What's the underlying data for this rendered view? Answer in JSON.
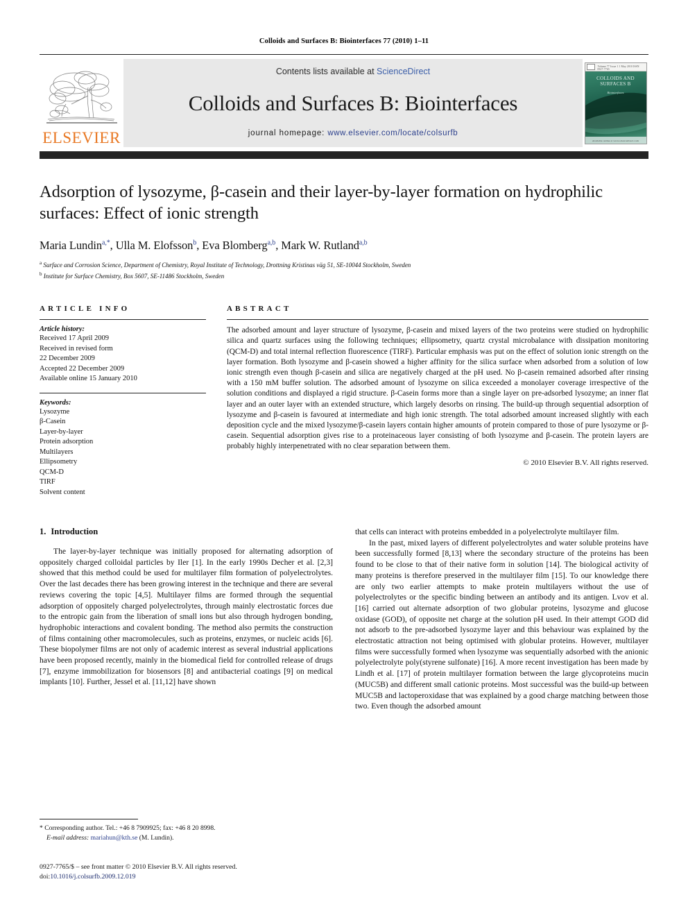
{
  "running_head": "Colloids and Surfaces B: Biointerfaces 77 (2010) 1–11",
  "masthead": {
    "contents_prefix": "Contents lists available at ",
    "sciencedirect": "ScienceDirect",
    "journal_name": "Colloids and Surfaces B: Biointerfaces",
    "homepage_label": "journal homepage:",
    "homepage_url": "www.elsevier.com/locate/colsurfb",
    "publisher_logo_text": "ELSEVIER",
    "cover": {
      "title": "COLLOIDS AND SURFACES B",
      "subtitle": "Biointerfaces",
      "top_strip": "Volume 77  Issue 1  1 May 2010    ISSN 0927-7765",
      "bottom_strip": "Available online at www.sciencedirect.com"
    }
  },
  "article": {
    "title": "Adsorption of lysozyme, β-casein and their layer-by-layer formation on hydrophilic surfaces: Effect of ionic strength",
    "authors": [
      {
        "name": "Maria Lundin",
        "sup": "a,*"
      },
      {
        "name": "Ulla M. Elofsson",
        "sup": "b"
      },
      {
        "name": "Eva Blomberg",
        "sup": "a,b"
      },
      {
        "name": "Mark W. Rutland",
        "sup": "a,b"
      }
    ],
    "affiliations": [
      {
        "mark": "a",
        "text": "Surface and Corrosion Science, Department of Chemistry, Royal Institute of Technology, Drottning Kristinas väg 51, SE-10044 Stockholm, Sweden"
      },
      {
        "mark": "b",
        "text": "Institute for Surface Chemistry, Box 5607, SE-11486 Stockholm, Sweden"
      }
    ]
  },
  "article_info": {
    "heading": "ARTICLE INFO",
    "history_label": "Article history:",
    "history": [
      "Received 17 April 2009",
      "Received in revised form",
      "22 December 2009",
      "Accepted 22 December 2009",
      "Available online 15 January 2010"
    ],
    "keywords_label": "Keywords:",
    "keywords": [
      "Lysozyme",
      "β-Casein",
      "Layer-by-layer",
      "Protein adsorption",
      "Multilayers",
      "Ellipsometry",
      "QCM-D",
      "TIRF",
      "Solvent content"
    ]
  },
  "abstract": {
    "heading": "ABSTRACT",
    "text": "The adsorbed amount and layer structure of lysozyme, β-casein and mixed layers of the two proteins were studied on hydrophilic silica and quartz surfaces using the following techniques; ellipsometry, quartz crystal microbalance with dissipation monitoring (QCM-D) and total internal reflection fluorescence (TIRF). Particular emphasis was put on the effect of solution ionic strength on the layer formation. Both lysozyme and β-casein showed a higher affinity for the silica surface when adsorbed from a solution of low ionic strength even though β-casein and silica are negatively charged at the pH used. No β-casein remained adsorbed after rinsing with a 150 mM buffer solution. The adsorbed amount of lysozyme on silica exceeded a monolayer coverage irrespective of the solution conditions and displayed a rigid structure. β-Casein forms more than a single layer on pre-adsorbed lysozyme; an inner flat layer and an outer layer with an extended structure, which largely desorbs on rinsing. The build-up through sequential adsorption of lysozyme and β-casein is favoured at intermediate and high ionic strength. The total adsorbed amount increased slightly with each deposition cycle and the mixed lysozyme/β-casein layers contain higher amounts of protein compared to those of pure lysozyme or β-casein. Sequential adsorption gives rise to a proteinaceous layer consisting of both lysozyme and β-casein. The protein layers are probably highly interpenetrated with no clear separation between them.",
    "copyright": "© 2010 Elsevier B.V. All rights reserved."
  },
  "body": {
    "section_number": "1.",
    "section_title": "Introduction",
    "left_paragraphs": [
      "The layer-by-layer technique was initially proposed for alternating adsorption of oppositely charged colloidal particles by Iler [1]. In the early 1990s Decher et al. [2,3] showed that this method could be used for multilayer film formation of polyelectrolytes. Over the last decades there has been growing interest in the technique and there are several reviews covering the topic [4,5]. Multilayer films are formed through the sequential adsorption of oppositely charged polyelectrolytes, through mainly electrostatic forces due to the entropic gain from the liberation of small ions but also through hydrogen bonding, hydrophobic interactions and covalent bonding. The method also permits the construction of films containing other macromolecules, such as proteins, enzymes, or nucleic acids [6]. These biopolymer films are not only of academic interest as several industrial applications have been proposed recently, mainly in the biomedical field for controlled release of drugs [7], enzyme immobilization for biosensors [8] and antibacterial coatings [9] on medical implants [10]. Further, Jessel et al. [11,12] have shown"
    ],
    "right_paragraphs": [
      "that cells can interact with proteins embedded in a polyelectrolyte multilayer film.",
      "In the past, mixed layers of different polyelectrolytes and water soluble proteins have been successfully formed [8,13] where the secondary structure of the proteins has been found to be close to that of their native form in solution [14]. The biological activity of many proteins is therefore preserved in the multilayer film [15]. To our knowledge there are only two earlier attempts to make protein multilayers without the use of polyelectrolytes or the specific binding between an antibody and its antigen. Lvov et al. [16] carried out alternate adsorption of two globular proteins, lysozyme and glucose oxidase (GOD), of opposite net charge at the solution pH used. In their attempt GOD did not adsorb to the pre-adsorbed lysozyme layer and this behaviour was explained by the electrostatic attraction not being optimised with globular proteins. However, multilayer films were successfully formed when lysozyme was sequentially adsorbed with the anionic polyelectrolyte poly(styrene sulfonate) [16]. A more recent investigation has been made by Lindh et al. [17] of protein multilayer formation between the large glycoproteins mucin (MUC5B) and different small cationic proteins. Most successful was the build-up between MUC5B and lactoperoxidase that was explained by a good charge matching between those two. Even though the adsorbed amount"
    ]
  },
  "footnote": {
    "corresponding": "* Corresponding author. Tel.: +46 8 7909925; fax: +46 8 20 8998.",
    "email_label": "E-mail address:",
    "email": "mariahun@kth.se",
    "email_suffix": "(M. Lundin)."
  },
  "imprint": {
    "issn_line": "0927-7765/$ – see front matter © 2010 Elsevier B.V. All rights reserved.",
    "doi_prefix": "doi:",
    "doi": "10.1016/j.colsurfb.2009.12.019"
  }
}
